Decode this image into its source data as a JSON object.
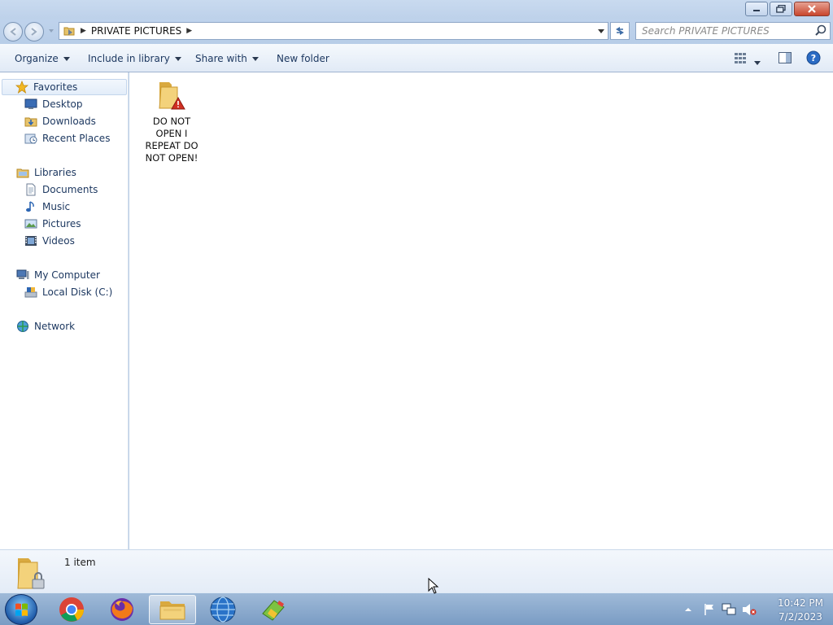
{
  "window": {
    "caption_buttons": [
      "minimize-icon",
      "restore-icon",
      "close-icon"
    ]
  },
  "address_bar": {
    "breadcrumb": [
      "PRIVATE PICTURES"
    ],
    "search_placeholder": "Search PRIVATE PICTURES"
  },
  "toolbar": {
    "organize": "Organize",
    "include_in_library": "Include in library",
    "share_with": "Share with",
    "new_folder": "New folder"
  },
  "nav_pane": {
    "favorites": "Favorites",
    "favorites_items": [
      "Desktop",
      "Downloads",
      "Recent Places"
    ],
    "libraries": "Libraries",
    "libraries_items": [
      "Documents",
      "Music",
      "Pictures",
      "Videos"
    ],
    "my_computer": "My Computer",
    "computer_items": [
      "Local Disk (C:)"
    ],
    "network": "Network"
  },
  "content": {
    "items": [
      {
        "name": "DO NOT OPEN I REPEAT DO NOT OPEN!",
        "icon": "folder-warning-icon"
      }
    ]
  },
  "details_pane": {
    "item_count": "1 item"
  },
  "taskbar": {
    "apps": [
      "chrome-icon",
      "firefox-icon",
      "file-explorer-icon",
      "globe-icon",
      "tool-icon"
    ],
    "active_app": "file-explorer-icon",
    "time": "10:42 PM",
    "date": "7/2/2023"
  },
  "colors": {
    "link_blue": "#1e3961",
    "window_frame": "#bcd0e8",
    "close_red": "#c8452c"
  }
}
